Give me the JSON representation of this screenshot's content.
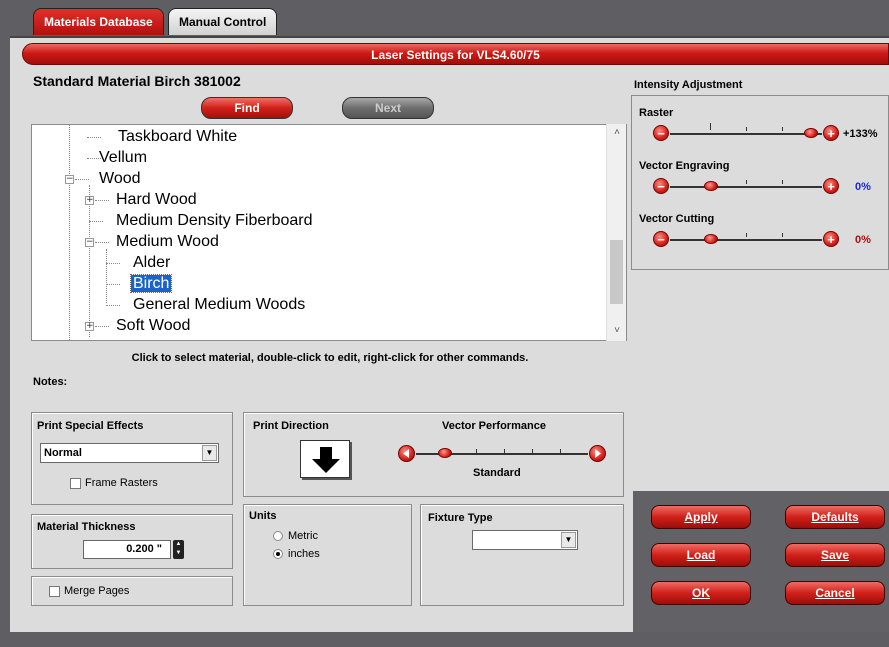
{
  "tabs": [
    {
      "label": "Materials Database"
    },
    {
      "label": "Manual Control"
    }
  ],
  "title_bar": "Laser Settings for VLS4.60/75",
  "standard_material": "Standard Material Birch 381002",
  "find_button": "Find",
  "next_button": "Next",
  "tree": {
    "items": [
      {
        "label": "Taskboard White"
      },
      {
        "label": "Vellum"
      },
      {
        "label": "Wood"
      },
      {
        "label": "Hard Wood"
      },
      {
        "label": "Medium Density Fiberboard"
      },
      {
        "label": "Medium Wood"
      },
      {
        "label": "Alder"
      },
      {
        "label": "Birch"
      },
      {
        "label": "General Medium Woods"
      },
      {
        "label": "Soft Wood"
      }
    ],
    "selected": "Birch"
  },
  "instructions": "Click to select material, double-click to edit, right-click for other commands.",
  "notes_label": "Notes:",
  "print_special_effects": {
    "title": "Print Special Effects",
    "value": "Normal",
    "frame_rasters_label": "Frame Rasters",
    "frame_rasters_checked": false
  },
  "material_thickness": {
    "title": "Material Thickness",
    "value": "0.200 \""
  },
  "merge_pages": {
    "label": "Merge Pages",
    "checked": false
  },
  "print_direction": {
    "title": "Print Direction"
  },
  "vector_performance": {
    "title": "Vector Performance",
    "value_label": "Standard",
    "level": 0.17
  },
  "units": {
    "title": "Units",
    "metric_label": "Metric",
    "inches_label": "inches",
    "selected": "inches"
  },
  "fixture_type": {
    "title": "Fixture Type",
    "value": ""
  },
  "intensity": {
    "title": "Intensity Adjustment",
    "raster": {
      "label": "Raster",
      "value": "+133%",
      "level": 0.93
    },
    "vector_engraving": {
      "label": "Vector Engraving",
      "value": "0%",
      "level": 0.27
    },
    "vector_cutting": {
      "label": "Vector Cutting",
      "value": "0%",
      "level": 0.27
    }
  },
  "colors": {
    "value_blue": "#1a2ad0",
    "value_red": "#b01010",
    "accent": "#d0211a"
  },
  "actions": {
    "apply": "Apply",
    "defaults": "Defaults",
    "load": "Load",
    "save": "Save",
    "ok": "OK",
    "cancel": "Cancel"
  }
}
